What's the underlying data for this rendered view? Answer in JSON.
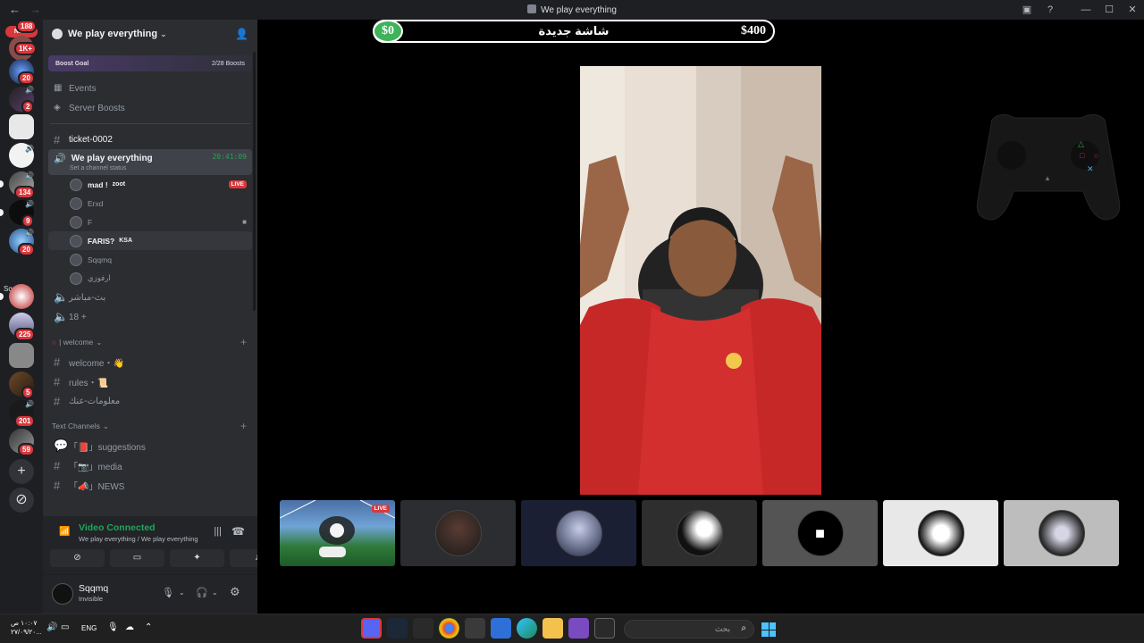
{
  "window": {
    "title": "We play everything"
  },
  "rail": {
    "new_label": "NEW",
    "folder_label": "Sqqmqs",
    "badges": [
      "188",
      "1K+",
      "20",
      "2",
      "134",
      "9",
      "20",
      "225",
      "5",
      "201",
      "59"
    ]
  },
  "server": {
    "name": "We play everything",
    "boost_goal": "Boost Goal",
    "boost_count": "2/28 Boosts",
    "events": "Events",
    "server_boosts": "Server Boosts"
  },
  "channels": {
    "ticket": "ticket-0002",
    "active_voice": {
      "name": "We play everything",
      "timer": "20:41:09",
      "status": "Set a channel status"
    },
    "voice_users": [
      {
        "name": "mad !",
        "tag": "zoot",
        "live": "LIVE"
      },
      {
        "name": "Erxd"
      },
      {
        "name": "F"
      },
      {
        "name": "FARIS?",
        "tag": "KSA"
      },
      {
        "name": "Sqqmq"
      },
      {
        "name": "ارفوزي"
      }
    ],
    "voice2": "بث-مباشر",
    "voice3": "18 +",
    "cat_welcome": "| welcome",
    "welcome": "welcome・👋",
    "rules": "rules・📜",
    "info": "معلومات-عنك",
    "cat_text": "Text Channels",
    "suggestions": "「📕」suggestions",
    "media": "「📷」media",
    "news": "「📣」NEWS"
  },
  "voice_panel": {
    "status": "Video Connected",
    "location": "We play everything / We play everything"
  },
  "user": {
    "name": "Sqqmq",
    "status": "Invisible"
  },
  "stage": {
    "money_left": "$0",
    "banner": "شاشة جديدة",
    "money_right": "$400",
    "tile_live": "LIVE"
  },
  "taskbar": {
    "time": "١٠:٠٧ ص",
    "date": "٢٧/٠٩/٢٠...",
    "lang": "ENG",
    "search_placeholder": "بحث"
  },
  "colors": {
    "accent_green": "#23a55a",
    "live_red": "#da373c",
    "money_green": "#3db35a"
  }
}
